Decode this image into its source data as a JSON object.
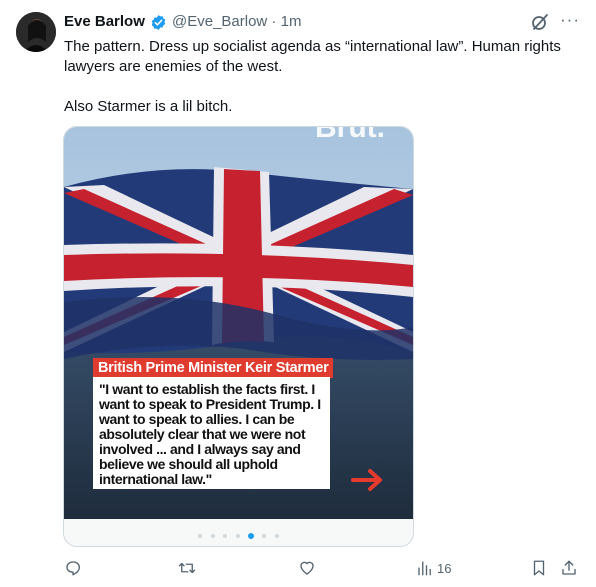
{
  "author": {
    "name": "Eve Barlow",
    "handle": "@Eve_Barlow · 1m",
    "verified": true
  },
  "tweet": {
    "text": "The pattern. Dress up socialist agenda as “international law”. Human rights lawyers are enemies of the west.\n\nAlso Starmer is a lil bitch."
  },
  "media": {
    "watermark": "Brut.",
    "label": "British Prime Minister Keir Starmer",
    "quote": "\"I want to establish the facts first. I want to speak to President Trump. I want to speak to allies. I can be absolutely clear that we were not involved ... and I always say and believe we should all uphold international law.\"",
    "carousel_dots": 7,
    "carousel_active_index": 4
  },
  "actions": {
    "views": "16"
  },
  "colors": {
    "verified_blue": "#1d9bf0",
    "label_red": "#e03b2f",
    "muted": "#536471"
  },
  "icons": [
    "verified-badge-icon",
    "grok-icon",
    "more-icon",
    "reply-icon",
    "retweet-icon",
    "like-icon",
    "views-icon",
    "bookmark-icon",
    "share-icon"
  ]
}
